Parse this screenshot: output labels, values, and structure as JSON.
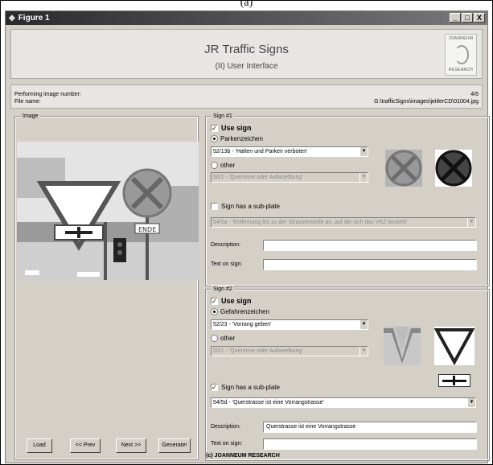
{
  "caption": "(a)",
  "window": {
    "title": "Figure 1",
    "buttons": [
      "_",
      "□",
      "X"
    ]
  },
  "header": {
    "title": "JR Traffic Signs",
    "subtitle": "(II) User Interface",
    "logo": {
      "top": "JOANNEUM",
      "bottom": "RESEARCH"
    }
  },
  "info": {
    "image_number_label": "Performing image number:",
    "file_name_label": "File name:",
    "image_number_value": "4/6",
    "file_name_value": "G:\\trafficSigns\\images\\jeitlerCD\\01004.jpg"
  },
  "image_panel": {
    "title": "Image"
  },
  "buttons": {
    "load": "Load",
    "prev": "<< Prev",
    "next": "Next >>",
    "generate": "Generate!"
  },
  "sign1": {
    "title": "Sign #1",
    "use_sign": "Use sign",
    "use_sign_checked": true,
    "category": "Parkenzeichen",
    "category_selected": true,
    "sign_value": "52/13b - 'Halten und Parken verboten'",
    "other_label": "other",
    "other_value": "50/1 - 'Querrinne oder Aufwoelbung'",
    "subplate_label": "Sign has a sub-plate",
    "subplate_checked": false,
    "subplate_value": "54/5a - 'Entfernung bis zu der Strassenstelle an, auf die sich das VKZ bezieht'",
    "description_label": "Description:",
    "description_value": "",
    "text_label": "Text on sign:",
    "text_value": ""
  },
  "sign2": {
    "title": "Sign #2",
    "use_sign": "Use sign",
    "use_sign_checked": true,
    "category": "Gefahrenzeichen",
    "category_selected": true,
    "sign_value": "52/23 - 'Vorrang geben'",
    "other_label": "other",
    "other_value": "50/1 - 'Querrinne oder Aufwoelbung'",
    "subplate_label": "Sign has a sub-plate",
    "subplate_checked": true,
    "subplate_value": "54/5d - 'Querstrasse ist eine Vorrangstrasse'",
    "description_label": "Description:",
    "description_value": "Querstrasse ist eine Vorrangstrasse",
    "text_label": "Text on sign:",
    "text_value": ""
  },
  "footer": "(c) JOANNEUM RESEARCH",
  "colors": {
    "titlebar": "#3a3a3a",
    "window_bg": "#d4d0c8",
    "sign_red": "#8a8a8a"
  }
}
